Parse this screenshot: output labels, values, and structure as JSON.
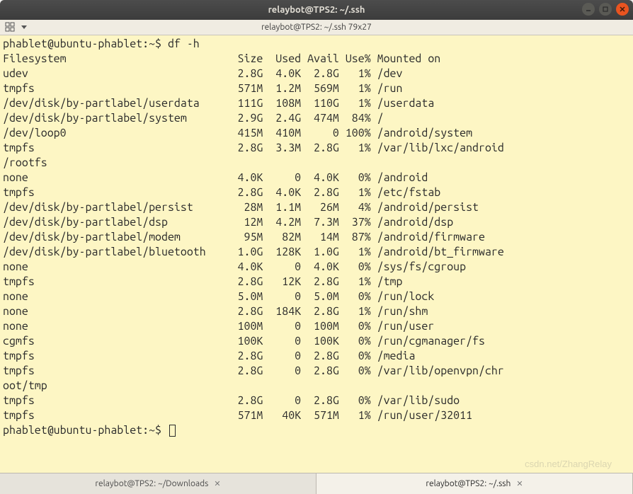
{
  "window": {
    "title": "relaybot@TPS2: ~/.ssh",
    "subtitle": "relaybot@TPS2: ~/.ssh 79x27"
  },
  "prompt": {
    "user_host": "phablet@ubuntu-phablet:~$",
    "command": "df -h"
  },
  "headers": {
    "fs": "Filesystem",
    "size": "Size",
    "used": "Used",
    "avail": "Avail",
    "usep": "Use%",
    "mount": "Mounted on"
  },
  "rows": [
    {
      "fs": "udev",
      "size": "2.8G",
      "used": "4.0K",
      "avail": "2.8G",
      "usep": "1%",
      "mount": "/dev"
    },
    {
      "fs": "tmpfs",
      "size": "571M",
      "used": "1.2M",
      "avail": "569M",
      "usep": "1%",
      "mount": "/run"
    },
    {
      "fs": "/dev/disk/by-partlabel/userdata",
      "size": "111G",
      "used": "108M",
      "avail": "110G",
      "usep": "1%",
      "mount": "/userdata"
    },
    {
      "fs": "/dev/disk/by-partlabel/system",
      "size": "2.9G",
      "used": "2.4G",
      "avail": "474M",
      "usep": "84%",
      "mount": "/"
    },
    {
      "fs": "/dev/loop0",
      "size": "415M",
      "used": "410M",
      "avail": "0",
      "usep": "100%",
      "mount": "/android/system"
    },
    {
      "fs": "tmpfs",
      "size": "2.8G",
      "used": "3.3M",
      "avail": "2.8G",
      "usep": "1%",
      "mount": "/var/lib/lxc/android/rootfs",
      "wrap": true
    },
    {
      "fs": "none",
      "size": "4.0K",
      "used": "0",
      "avail": "4.0K",
      "usep": "0%",
      "mount": "/android"
    },
    {
      "fs": "tmpfs",
      "size": "2.8G",
      "used": "4.0K",
      "avail": "2.8G",
      "usep": "1%",
      "mount": "/etc/fstab"
    },
    {
      "fs": "/dev/disk/by-partlabel/persist",
      "size": "28M",
      "used": "1.1M",
      "avail": "26M",
      "usep": "4%",
      "mount": "/android/persist"
    },
    {
      "fs": "/dev/disk/by-partlabel/dsp",
      "size": "12M",
      "used": "4.2M",
      "avail": "7.3M",
      "usep": "37%",
      "mount": "/android/dsp"
    },
    {
      "fs": "/dev/disk/by-partlabel/modem",
      "size": "95M",
      "used": "82M",
      "avail": "14M",
      "usep": "87%",
      "mount": "/android/firmware"
    },
    {
      "fs": "/dev/disk/by-partlabel/bluetooth",
      "size": "1.0G",
      "used": "128K",
      "avail": "1.0G",
      "usep": "1%",
      "mount": "/android/bt_firmware"
    },
    {
      "fs": "none",
      "size": "4.0K",
      "used": "0",
      "avail": "4.0K",
      "usep": "0%",
      "mount": "/sys/fs/cgroup"
    },
    {
      "fs": "tmpfs",
      "size": "2.8G",
      "used": "12K",
      "avail": "2.8G",
      "usep": "1%",
      "mount": "/tmp"
    },
    {
      "fs": "none",
      "size": "5.0M",
      "used": "0",
      "avail": "5.0M",
      "usep": "0%",
      "mount": "/run/lock"
    },
    {
      "fs": "none",
      "size": "2.8G",
      "used": "184K",
      "avail": "2.8G",
      "usep": "1%",
      "mount": "/run/shm"
    },
    {
      "fs": "none",
      "size": "100M",
      "used": "0",
      "avail": "100M",
      "usep": "0%",
      "mount": "/run/user"
    },
    {
      "fs": "cgmfs",
      "size": "100K",
      "used": "0",
      "avail": "100K",
      "usep": "0%",
      "mount": "/run/cgmanager/fs"
    },
    {
      "fs": "tmpfs",
      "size": "2.8G",
      "used": "0",
      "avail": "2.8G",
      "usep": "0%",
      "mount": "/media"
    },
    {
      "fs": "tmpfs",
      "size": "2.8G",
      "used": "0",
      "avail": "2.8G",
      "usep": "0%",
      "mount": "/var/lib/openvpn/chroot/tmp",
      "wrap": true
    },
    {
      "fs": "tmpfs",
      "size": "2.8G",
      "used": "0",
      "avail": "2.8G",
      "usep": "0%",
      "mount": "/var/lib/sudo"
    },
    {
      "fs": "tmpfs",
      "size": "571M",
      "used": "40K",
      "avail": "571M",
      "usep": "1%",
      "mount": "/run/user/32011"
    }
  ],
  "col_widths": {
    "fs": 35,
    "size": 6,
    "used": 6,
    "avail": 6,
    "usep": 5
  },
  "term_cols": 79,
  "tabs": [
    {
      "label": "relaybot@TPS2: ~/Downloads",
      "active": false
    },
    {
      "label": "relaybot@TPS2: ~/.ssh",
      "active": true
    }
  ],
  "watermark": "csdn.net/ZhangRelay"
}
